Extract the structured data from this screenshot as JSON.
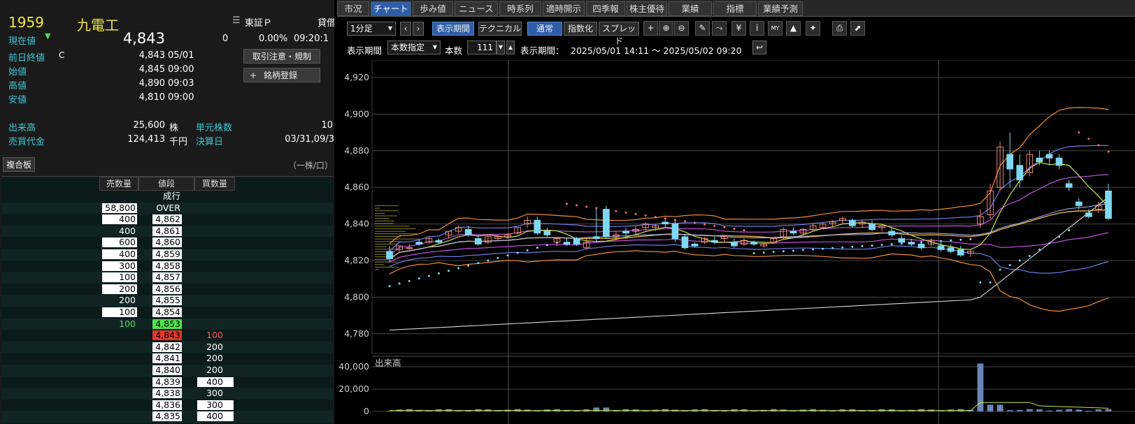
{
  "stock": {
    "code": "1959",
    "name": "九電工",
    "current_label": "現在値",
    "price": "4,843",
    "change": "0",
    "change_pct": "0.00%",
    "time": "09:20:1",
    "market": "東証Ｐ",
    "market_extra": "貸借",
    "prev_close_label": "前日終値",
    "prev_close_flag": "C",
    "prev_close": "4,843",
    "prev_close_date": "05/01",
    "open_label": "始値",
    "open": "4,845",
    "open_time": "09:00",
    "high_label": "高値",
    "high": "4,890",
    "high_time": "09:03",
    "low_label": "安値",
    "low": "4,810",
    "low_time": "09:00",
    "volume_label": "出来高",
    "volume": "25,600",
    "volume_unit": "株",
    "unit_label": "単元株数",
    "unit": "10",
    "turnover_label": "売買代金",
    "turnover": "124,413",
    "turnover_unit": "千円",
    "settle_label": "決算日",
    "settle": "03/31,09/3"
  },
  "buttons": {
    "caution": "取引注意・規制",
    "register_icon": "+",
    "register": "銘柄登録",
    "memo_icon": "memo-icon"
  },
  "board": {
    "title": "複合板",
    "unit_note": "（一株/口）",
    "headers": {
      "sell": "売数量",
      "price": "値段",
      "buy": "買数量"
    },
    "rows": [
      {
        "sell": "",
        "price": "成行",
        "buy": "",
        "sell_style": "",
        "price_style": "txt-w",
        "buy_style": ""
      },
      {
        "sell": "58,800",
        "price": "OVER",
        "buy": "",
        "sell_style": "box-w",
        "price_style": "txt-w",
        "buy_style": ""
      },
      {
        "sell": "400",
        "price": "4,862",
        "buy": "",
        "sell_style": "box-w",
        "price_style": "box-w",
        "buy_style": ""
      },
      {
        "sell": "400",
        "price": "4,861",
        "buy": "",
        "sell_style": "txt-w",
        "price_style": "box-w",
        "buy_style": ""
      },
      {
        "sell": "600",
        "price": "4,860",
        "buy": "",
        "sell_style": "box-w",
        "price_style": "box-w",
        "buy_style": ""
      },
      {
        "sell": "400",
        "price": "4,859",
        "buy": "",
        "sell_style": "box-w",
        "price_style": "box-w",
        "buy_style": ""
      },
      {
        "sell": "300",
        "price": "4,858",
        "buy": "",
        "sell_style": "box-w",
        "price_style": "box-w",
        "buy_style": ""
      },
      {
        "sell": "100",
        "price": "4,857",
        "buy": "",
        "sell_style": "box-w",
        "price_style": "box-w",
        "buy_style": ""
      },
      {
        "sell": "200",
        "price": "4,856",
        "buy": "",
        "sell_style": "box-w",
        "price_style": "box-w",
        "buy_style": ""
      },
      {
        "sell": "200",
        "price": "4,855",
        "buy": "",
        "sell_style": "txt-w",
        "price_style": "box-w",
        "buy_style": ""
      },
      {
        "sell": "100",
        "price": "4,854",
        "buy": "",
        "sell_style": "box-w",
        "price_style": "box-w",
        "buy_style": ""
      },
      {
        "sell": "100",
        "price": "4,853",
        "buy": "",
        "sell_style": "txt-g",
        "price_style": "box-g",
        "buy_style": ""
      },
      {
        "sell": "",
        "price": "4,843",
        "buy": "100",
        "sell_style": "",
        "price_style": "box-r",
        "buy_style": "txt-r"
      },
      {
        "sell": "",
        "price": "4,842",
        "buy": "200",
        "sell_style": "",
        "price_style": "box-w",
        "buy_style": "txt-w"
      },
      {
        "sell": "",
        "price": "4,841",
        "buy": "200",
        "sell_style": "",
        "price_style": "box-w",
        "buy_style": "txt-w"
      },
      {
        "sell": "",
        "price": "4,840",
        "buy": "200",
        "sell_style": "",
        "price_style": "box-w",
        "buy_style": "txt-w"
      },
      {
        "sell": "",
        "price": "4,839",
        "buy": "400",
        "sell_style": "",
        "price_style": "box-w",
        "buy_style": "box-w"
      },
      {
        "sell": "",
        "price": "4,838",
        "buy": "300",
        "sell_style": "",
        "price_style": "box-w",
        "buy_style": "txt-w"
      },
      {
        "sell": "",
        "price": "4,836",
        "buy": "300",
        "sell_style": "",
        "price_style": "box-w",
        "buy_style": "box-w"
      },
      {
        "sell": "",
        "price": "4,835",
        "buy": "400",
        "sell_style": "",
        "price_style": "box-w",
        "buy_style": "box-w"
      }
    ]
  },
  "tabs": [
    {
      "label": "市況",
      "active": false
    },
    {
      "label": "チャート",
      "active": true
    },
    {
      "label": "歩み値",
      "active": false
    },
    {
      "label": "ニュース",
      "active": false
    },
    {
      "label": "時系列",
      "active": false
    },
    {
      "label": "適時開示",
      "active": false
    },
    {
      "label": "四季報",
      "active": false
    },
    {
      "label": "株主優待",
      "active": false
    },
    {
      "label": "業績",
      "active": false
    },
    {
      "label": "指標",
      "active": false
    },
    {
      "label": "業績予測",
      "active": false
    }
  ],
  "toolbar": {
    "interval": "1分足",
    "period_btn": "表示期間",
    "technical_btn": "テクニカル",
    "normal_btn": "通常",
    "index_btn": "指数化",
    "spread_btn": "スプレッド",
    "icons": [
      "crosshair-icon",
      "zoom-in-icon",
      "zoom-out-icon",
      "pen-icon",
      "cursor-icon",
      "yen-icon",
      "info-icon",
      "compare-icon",
      "area-icon",
      "wrench-icon",
      "print-icon",
      "export-icon"
    ],
    "icon_glyphs": [
      "+",
      "⊕",
      "⊖",
      "✎",
      "⤳",
      "¥",
      "i",
      "MY",
      "▲",
      "✦",
      "⎙",
      "⬈"
    ]
  },
  "period_bar": {
    "label": "表示期間",
    "mode": "本数指定",
    "count_label": "本数",
    "count": "111",
    "range_label": "表示期間：",
    "range": "2025/05/01 14:11 ～ 2025/05/02 09:20",
    "reset_icon": "return-icon"
  },
  "colors": {
    "up": "#ee8878",
    "down": "#7fd8f2",
    "bb_outer": "#ef8c3c",
    "bb_mid": "#c24fe0",
    "bb_inner": "#6f7ae8",
    "ma_short": "#c8e84a",
    "ma_long": "#e8b040",
    "sar_up": "#7fd8f2",
    "sar_down": "#ff6a70",
    "volume_line": "#d8d8d8",
    "volume_bar": "#6a86b8"
  },
  "chart_data": {
    "type": "candlestick",
    "ylim": [
      4770,
      4928
    ],
    "yticks": [
      "4,920",
      "4,900",
      "4,880",
      "4,860",
      "4,840",
      "4,820",
      "4,800",
      "4,780"
    ],
    "ytick_values": [
      4920,
      4900,
      4880,
      4860,
      4840,
      4820,
      4800,
      4780
    ],
    "candles": [
      [
        4825,
        4828,
        4819,
        4821
      ],
      [
        4826,
        4828,
        4825,
        4828
      ],
      [
        4827,
        4829,
        4826,
        4827
      ],
      [
        4830,
        4832,
        4828,
        4829
      ],
      [
        4830,
        4833,
        4829,
        4832
      ],
      [
        4831,
        4832,
        4829,
        4830
      ],
      [
        4834,
        4836,
        4832,
        4836
      ],
      [
        4836,
        4839,
        4835,
        4838
      ],
      [
        4837,
        4839,
        4833,
        4834
      ],
      [
        4832,
        4834,
        4828,
        4829
      ],
      [
        4830,
        4834,
        4829,
        4833
      ],
      [
        4832,
        4834,
        4831,
        4833
      ],
      [
        4833,
        4835,
        4832,
        4834
      ],
      [
        4835,
        4838,
        4834,
        4838
      ],
      [
        4840,
        4844,
        4838,
        4842
      ],
      [
        4842,
        4844,
        4834,
        4835
      ],
      [
        4836,
        4838,
        4833,
        4834
      ],
      [
        4830,
        4833,
        4828,
        4832
      ],
      [
        4830,
        4832,
        4828,
        4829
      ],
      [
        4832,
        4833,
        4828,
        4829
      ],
      [
        4827,
        4832,
        4826,
        4830
      ],
      [
        4833,
        4848,
        4830,
        4832
      ],
      [
        4848,
        4850,
        4832,
        4833
      ],
      [
        4833,
        4836,
        4831,
        4834
      ],
      [
        4836,
        4838,
        4833,
        4835
      ],
      [
        4836,
        4839,
        4834,
        4837
      ],
      [
        4838,
        4841,
        4836,
        4840
      ],
      [
        4838,
        4840,
        4836,
        4839
      ],
      [
        4841,
        4843,
        4838,
        4840
      ],
      [
        4840,
        4842,
        4830,
        4832
      ],
      [
        4833,
        4834,
        4826,
        4827
      ],
      [
        4829,
        4830,
        4827,
        4828
      ],
      [
        4830,
        4833,
        4829,
        4832
      ],
      [
        4831,
        4833,
        4829,
        4830
      ],
      [
        4832,
        4834,
        4830,
        4833
      ],
      [
        4830,
        4832,
        4827,
        4828
      ],
      [
        4829,
        4832,
        4828,
        4831
      ],
      [
        4830,
        4831,
        4828,
        4829
      ],
      [
        4828,
        4830,
        4827,
        4829
      ],
      [
        4830,
        4833,
        4829,
        4832
      ],
      [
        4833,
        4838,
        4832,
        4837
      ],
      [
        4836,
        4838,
        4834,
        4835
      ],
      [
        4835,
        4838,
        4834,
        4837
      ],
      [
        4837,
        4840,
        4836,
        4839
      ],
      [
        4838,
        4841,
        4837,
        4840
      ],
      [
        4840,
        4842,
        4838,
        4841
      ],
      [
        4842,
        4844,
        4840,
        4843
      ],
      [
        4842,
        4843,
        4838,
        4839
      ],
      [
        4840,
        4842,
        4838,
        4841
      ],
      [
        4840,
        4842,
        4836,
        4837
      ],
      [
        4838,
        4840,
        4836,
        4839
      ],
      [
        4836,
        4838,
        4833,
        4834
      ],
      [
        4832,
        4834,
        4829,
        4830
      ],
      [
        4830,
        4832,
        4828,
        4829
      ],
      [
        4829,
        4831,
        4826,
        4827
      ],
      [
        4829,
        4832,
        4828,
        4831
      ],
      [
        4828,
        4830,
        4825,
        4826
      ],
      [
        4827,
        4829,
        4824,
        4825
      ],
      [
        4826,
        4828,
        4822,
        4823
      ],
      [
        4824,
        4826,
        4822,
        4825
      ],
      [
        4840,
        4848,
        4838,
        4844
      ],
      [
        4845,
        4862,
        4843,
        4858
      ],
      [
        4860,
        4885,
        4858,
        4882
      ],
      [
        4878,
        4890,
        4860,
        4870
      ],
      [
        4872,
        4878,
        4860,
        4864
      ],
      [
        4868,
        4880,
        4866,
        4878
      ],
      [
        4876,
        4880,
        4872,
        4874
      ],
      [
        4878,
        4880,
        4872,
        4876
      ],
      [
        4876,
        4878,
        4870,
        4872
      ],
      [
        4862,
        4864,
        4858,
        4860
      ],
      [
        4852,
        4854,
        4848,
        4850
      ],
      [
        4846,
        4848,
        4843,
        4844
      ],
      [
        4848,
        4852,
        4846,
        4850
      ],
      [
        4858,
        4862,
        4842,
        4843
      ]
    ],
    "volume_ticks": [
      "40,000",
      "20,000",
      "0"
    ],
    "volume_tick_values": [
      40000,
      20000,
      0
    ],
    "volume_label": "出来高",
    "volume_ylim": [
      0,
      47000
    ],
    "volume_spike_index": 60,
    "volume_spike": 43000
  }
}
